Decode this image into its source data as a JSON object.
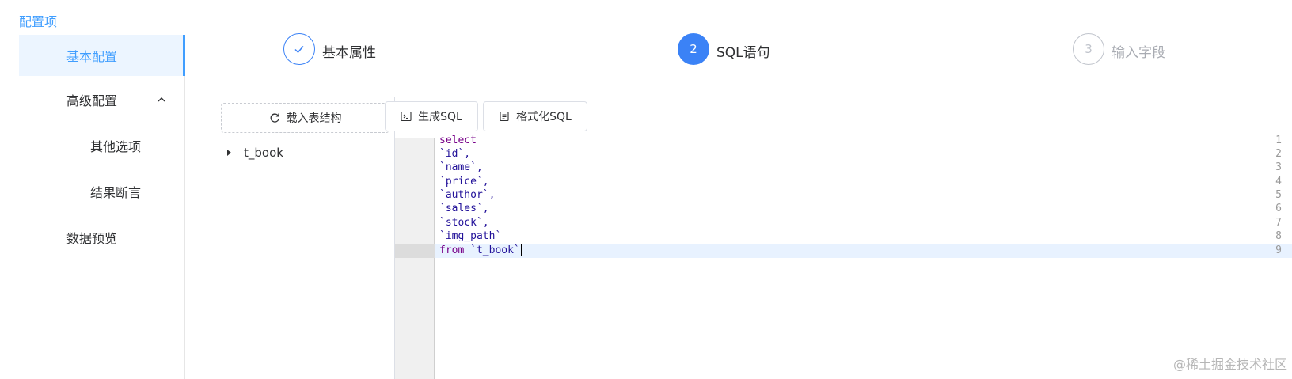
{
  "sidebar": {
    "title": "配置项",
    "items": [
      {
        "label": "基本配置"
      },
      {
        "label": "高级配置"
      },
      {
        "label": "其他选项"
      },
      {
        "label": "结果断言"
      },
      {
        "label": "数据预览"
      }
    ]
  },
  "steps": [
    {
      "number": "1",
      "label": "基本属性",
      "status": "done"
    },
    {
      "number": "2",
      "label": "SQL语句",
      "status": "current"
    },
    {
      "number": "3",
      "label": "输入字段",
      "status": "wait"
    }
  ],
  "left_pane": {
    "load_button": "载入表结构",
    "tree": [
      {
        "label": "t_book"
      }
    ]
  },
  "toolbar": {
    "generate_sql": "生成SQL",
    "format_sql": "格式化SQL"
  },
  "editor": {
    "line_numbers": [
      "1",
      "2",
      "3",
      "4",
      "5",
      "6",
      "7",
      "8",
      "9"
    ],
    "lines": [
      {
        "kw": "select",
        "text": ""
      },
      {
        "kw": "",
        "text": "`id`,"
      },
      {
        "kw": "",
        "text": "`name`,"
      },
      {
        "kw": "",
        "text": "`price`,"
      },
      {
        "kw": "",
        "text": "`author`,"
      },
      {
        "kw": "",
        "text": "`sales`,"
      },
      {
        "kw": "",
        "text": "`stock`,"
      },
      {
        "kw": "",
        "text": "`img_path`"
      },
      {
        "kw": "from",
        "text": " `t_book`"
      }
    ],
    "active_line": 9
  },
  "watermark": "@稀土掘金技术社区",
  "colors": {
    "accent": "#409eff",
    "step_active": "#3b82f6"
  }
}
